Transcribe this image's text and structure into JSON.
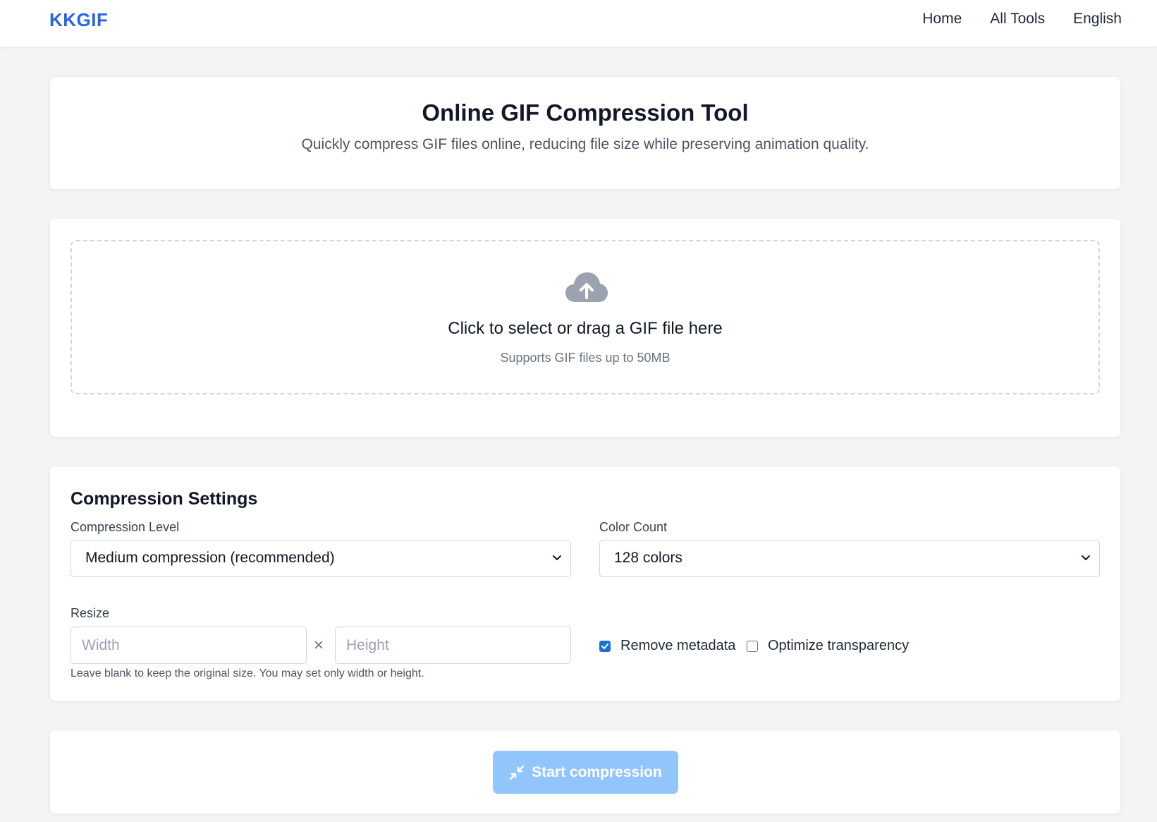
{
  "header": {
    "brand": "KKGIF",
    "nav": [
      {
        "label": "Home"
      },
      {
        "label": "All Tools"
      },
      {
        "label": "English"
      }
    ]
  },
  "intro": {
    "title": "Online GIF Compression Tool",
    "subtitle": "Quickly compress GIF files online, reducing file size while preserving animation quality."
  },
  "upload": {
    "icon": "cloud-upload-icon",
    "title": "Click to select or drag a GIF file here",
    "subtitle": "Supports GIF files up to 50MB"
  },
  "settings": {
    "title": "Compression Settings",
    "compression_level": {
      "label": "Compression Level",
      "value": "Medium compression (recommended)"
    },
    "color_count": {
      "label": "Color Count",
      "value": "128 colors"
    },
    "resize": {
      "label": "Resize",
      "width_placeholder": "Width",
      "height_placeholder": "Height",
      "separator": "×",
      "hint": "Leave blank to keep the original size. You may set only width or height."
    },
    "remove_metadata": {
      "label": "Remove metadata",
      "checked": true
    },
    "optimize_transparency": {
      "label": "Optimize transparency",
      "checked": false
    }
  },
  "action": {
    "start_label": "Start compression",
    "icon": "compress-icon",
    "disabled": true
  },
  "colors": {
    "brand": "#2563eb",
    "button_disabled": "#93c5fd",
    "checkbox_checked": "#1d6fd9"
  }
}
